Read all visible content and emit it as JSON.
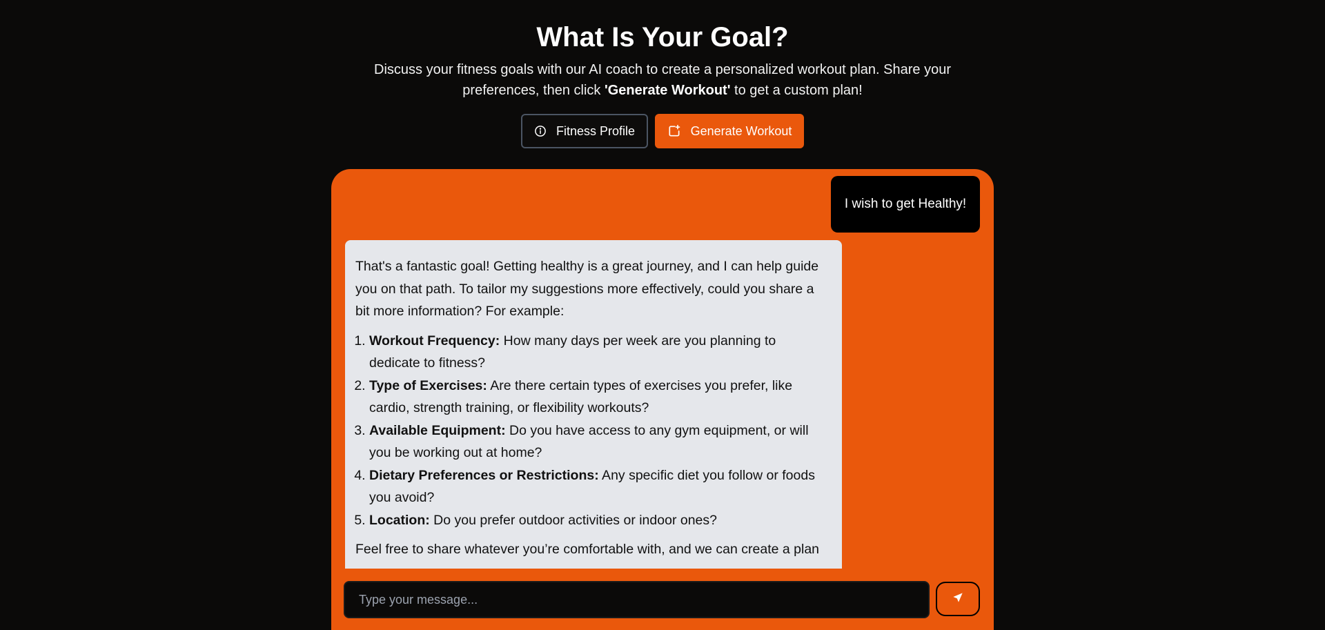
{
  "header": {
    "title": "What Is Your Goal?",
    "subtitle_before": "Discuss your fitness goals with our AI coach to create a personalized workout plan. Share your preferences, then click ",
    "subtitle_bold": "'Generate Workout'",
    "subtitle_after": " to get a custom plan!"
  },
  "actions": {
    "profile_label": "Fitness Profile",
    "profile_icon": "info-circle-icon",
    "generate_label": "Generate Workout",
    "generate_icon": "calendar-plus-icon"
  },
  "chat": {
    "user_message": "I wish to get Healthy!",
    "ai_intro": "That's a fantastic goal! Getting healthy is a great journey, and I can help guide you on that path. To tailor my suggestions more effectively, could you share a bit more information? For example:",
    "ai_questions": [
      {
        "title": "Workout Frequency:",
        "text": " How many days per week are you planning to dedicate to fitness?"
      },
      {
        "title": "Type of Exercises:",
        "text": " Are there certain types of exercises you prefer, like cardio, strength training, or flexibility workouts?"
      },
      {
        "title": "Available Equipment:",
        "text": " Do you have access to any gym equipment, or will you be working out at home?"
      },
      {
        "title": "Dietary Preferences or Restrictions:",
        "text": " Any specific diet you follow or foods you avoid?"
      },
      {
        "title": "Location:",
        "text": " Do you prefer outdoor activities or indoor ones?"
      }
    ],
    "ai_outro": "Feel free to share whatever you’re comfortable with, and we can create a plan"
  },
  "composer": {
    "placeholder": "Type your message...",
    "value": "",
    "send_icon": "send-arrow-icon"
  },
  "colors": {
    "background": "#0b0a09",
    "accent": "#ea580c",
    "ai_bubble": "#e5e7eb",
    "user_bubble": "#000000"
  }
}
